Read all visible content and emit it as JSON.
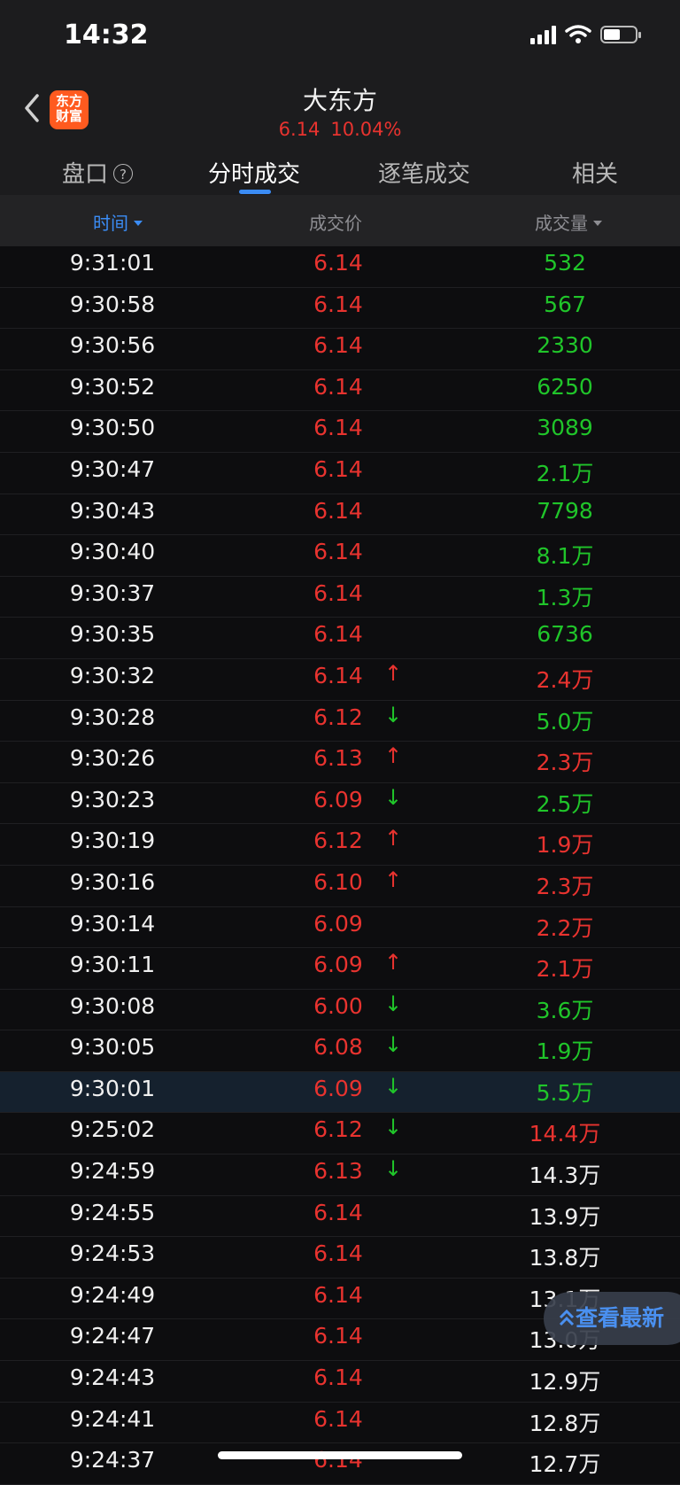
{
  "status": {
    "time": "14:32"
  },
  "nav": {
    "logo_text": "东方\n财富",
    "title": "大东方",
    "price": "6.14",
    "change_pct": "10.04%"
  },
  "tabs": [
    {
      "label": "盘口",
      "active": false
    },
    {
      "label": "分时成交",
      "active": true
    },
    {
      "label": "逐笔成交",
      "active": false
    },
    {
      "label": "相关",
      "active": false
    }
  ],
  "help_glyph": "?",
  "columns": {
    "time": "时间",
    "price": "成交价",
    "volume": "成交量"
  },
  "arrow_glyphs": {
    "up": "↑",
    "down": "↓"
  },
  "rows": [
    {
      "time": "9:31:01",
      "price": "6.14",
      "arrow": "",
      "volume": "532",
      "vol_color": "green"
    },
    {
      "time": "9:30:58",
      "price": "6.14",
      "arrow": "",
      "volume": "567",
      "vol_color": "green"
    },
    {
      "time": "9:30:56",
      "price": "6.14",
      "arrow": "",
      "volume": "2330",
      "vol_color": "green"
    },
    {
      "time": "9:30:52",
      "price": "6.14",
      "arrow": "",
      "volume": "6250",
      "vol_color": "green"
    },
    {
      "time": "9:30:50",
      "price": "6.14",
      "arrow": "",
      "volume": "3089",
      "vol_color": "green"
    },
    {
      "time": "9:30:47",
      "price": "6.14",
      "arrow": "",
      "volume": "2.1万",
      "vol_color": "green"
    },
    {
      "time": "9:30:43",
      "price": "6.14",
      "arrow": "",
      "volume": "7798",
      "vol_color": "green"
    },
    {
      "time": "9:30:40",
      "price": "6.14",
      "arrow": "",
      "volume": "8.1万",
      "vol_color": "green"
    },
    {
      "time": "9:30:37",
      "price": "6.14",
      "arrow": "",
      "volume": "1.3万",
      "vol_color": "green"
    },
    {
      "time": "9:30:35",
      "price": "6.14",
      "arrow": "",
      "volume": "6736",
      "vol_color": "green"
    },
    {
      "time": "9:30:32",
      "price": "6.14",
      "arrow": "up",
      "volume": "2.4万",
      "vol_color": "red"
    },
    {
      "time": "9:30:28",
      "price": "6.12",
      "arrow": "down",
      "volume": "5.0万",
      "vol_color": "green"
    },
    {
      "time": "9:30:26",
      "price": "6.13",
      "arrow": "up",
      "volume": "2.3万",
      "vol_color": "red"
    },
    {
      "time": "9:30:23",
      "price": "6.09",
      "arrow": "down",
      "volume": "2.5万",
      "vol_color": "green"
    },
    {
      "time": "9:30:19",
      "price": "6.12",
      "arrow": "up",
      "volume": "1.9万",
      "vol_color": "red"
    },
    {
      "time": "9:30:16",
      "price": "6.10",
      "arrow": "up",
      "volume": "2.3万",
      "vol_color": "red"
    },
    {
      "time": "9:30:14",
      "price": "6.09",
      "arrow": "",
      "volume": "2.2万",
      "vol_color": "red"
    },
    {
      "time": "9:30:11",
      "price": "6.09",
      "arrow": "up",
      "volume": "2.1万",
      "vol_color": "red"
    },
    {
      "time": "9:30:08",
      "price": "6.00",
      "arrow": "down",
      "volume": "3.6万",
      "vol_color": "green"
    },
    {
      "time": "9:30:05",
      "price": "6.08",
      "arrow": "down",
      "volume": "1.9万",
      "vol_color": "green"
    },
    {
      "time": "9:30:01",
      "price": "6.09",
      "arrow": "down",
      "volume": "5.5万",
      "vol_color": "green",
      "highlight": true
    },
    {
      "time": "9:25:02",
      "price": "6.12",
      "arrow": "down",
      "volume": "14.4万",
      "vol_color": "red"
    },
    {
      "time": "9:24:59",
      "price": "6.13",
      "arrow": "down",
      "volume": "14.3万",
      "vol_color": "white"
    },
    {
      "time": "9:24:55",
      "price": "6.14",
      "arrow": "",
      "volume": "13.9万",
      "vol_color": "white"
    },
    {
      "time": "9:24:53",
      "price": "6.14",
      "arrow": "",
      "volume": "13.8万",
      "vol_color": "white"
    },
    {
      "time": "9:24:49",
      "price": "6.14",
      "arrow": "",
      "volume": "13.1万",
      "vol_color": "white"
    },
    {
      "time": "9:24:47",
      "price": "6.14",
      "arrow": "",
      "volume": "13.0万",
      "vol_color": "white"
    },
    {
      "time": "9:24:43",
      "price": "6.14",
      "arrow": "",
      "volume": "12.9万",
      "vol_color": "white"
    },
    {
      "time": "9:24:41",
      "price": "6.14",
      "arrow": "",
      "volume": "12.8万",
      "vol_color": "white"
    },
    {
      "time": "9:24:37",
      "price": "6.14",
      "arrow": "",
      "volume": "12.7万",
      "vol_color": "white"
    }
  ],
  "latest_button": {
    "label": "查看最新"
  },
  "colors": {
    "up": "#e8332f",
    "down": "#20c52a",
    "accent": "#3b8cf5"
  }
}
